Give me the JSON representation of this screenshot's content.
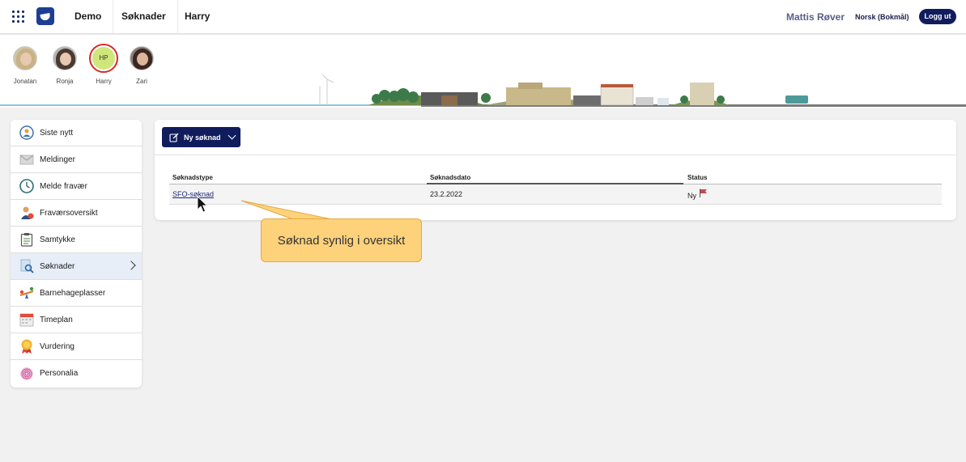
{
  "header": {
    "tabs": [
      "Demo",
      "Søknader",
      "Harry"
    ],
    "user_name": "Mattis Røver",
    "language": "Norsk (Bokmål)",
    "logout_label": "Logg ut"
  },
  "children": [
    {
      "name": "Jonatan",
      "active": false
    },
    {
      "name": "Ronja",
      "active": false
    },
    {
      "name": "Harry",
      "initials": "HP",
      "active": true
    },
    {
      "name": "Zari",
      "active": false
    }
  ],
  "sidebar": {
    "items": [
      {
        "label": "Siste nytt",
        "icon": "news-icon"
      },
      {
        "label": "Meldinger",
        "icon": "envelope-icon"
      },
      {
        "label": "Melde fravær",
        "icon": "clock-icon"
      },
      {
        "label": "Fraværsoversikt",
        "icon": "person-absence-icon"
      },
      {
        "label": "Samtykke",
        "icon": "clipboard-icon"
      },
      {
        "label": "Søknader",
        "icon": "document-search-icon",
        "active": true
      },
      {
        "label": "Barnehageplasser",
        "icon": "seesaw-icon"
      },
      {
        "label": "Timeplan",
        "icon": "calendar-icon"
      },
      {
        "label": "Vurdering",
        "icon": "medal-icon"
      },
      {
        "label": "Personalia",
        "icon": "fingerprint-icon"
      }
    ]
  },
  "main": {
    "new_button_label": "Ny søknad",
    "table": {
      "headers": [
        "Søknadstype",
        "Søknadsdato",
        "Status"
      ],
      "rows": [
        {
          "type": "SFO-søknad",
          "date": "23.2.2022",
          "status": "Ny"
        }
      ]
    }
  },
  "callout": {
    "text": "Søknad synlig i oversikt"
  },
  "colors": {
    "primary": "#101c5c",
    "callout": "#fdd27b",
    "active_ring": "#d62a2a",
    "status_flag": "#c94a4a"
  }
}
